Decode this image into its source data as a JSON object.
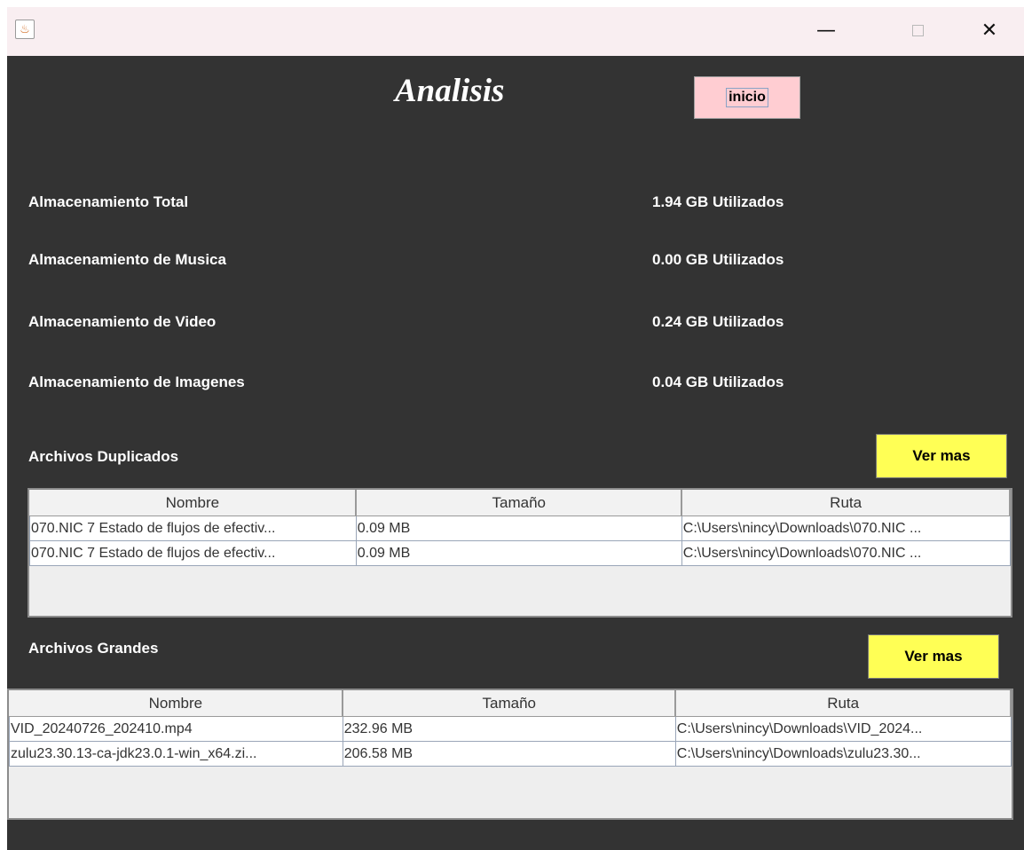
{
  "window": {
    "minimize_glyph": "—",
    "close_glyph": "✕",
    "icons": {
      "app": "java-app-icon",
      "minimize": "minimize-icon",
      "maximize": "maximize-icon",
      "close": "close-icon"
    }
  },
  "header": {
    "title": "Analisis",
    "inicio_label": "inicio"
  },
  "storage": [
    {
      "label": "Almacenamiento Total",
      "value": "1.94 GB Utilizados"
    },
    {
      "label": "Almacenamiento de Musica",
      "value": "0.00 GB Utilizados"
    },
    {
      "label": "Almacenamiento de Video",
      "value": "0.24 GB Utilizados"
    },
    {
      "label": "Almacenamiento de Imagenes",
      "value": "0.04 GB Utilizados"
    }
  ],
  "duplicados": {
    "title": "Archivos Duplicados",
    "button": "Ver mas",
    "columns": [
      "Nombre",
      "Tamaño",
      "Ruta"
    ],
    "rows": [
      [
        "070.NIC 7 Estado de flujos de efectiv...",
        "0.09 MB",
        "C:\\Users\\nincy\\Downloads\\070.NIC ..."
      ],
      [
        "070.NIC 7 Estado de flujos de efectiv...",
        "0.09 MB",
        "C:\\Users\\nincy\\Downloads\\070.NIC ..."
      ]
    ]
  },
  "grandes": {
    "title": "Archivos Grandes",
    "button": "Ver mas",
    "columns": [
      "Nombre",
      "Tamaño",
      "Ruta"
    ],
    "rows": [
      [
        "VID_20240726_202410.mp4",
        "232.96 MB",
        "C:\\Users\\nincy\\Downloads\\VID_2024..."
      ],
      [
        "zulu23.30.13-ca-jdk23.0.1-win_x64.zi...",
        "206.58 MB",
        "C:\\Users\\nincy\\Downloads\\zulu23.30..."
      ]
    ]
  },
  "colors": {
    "background": "#333333",
    "inicio_button": "#ffcdd2",
    "ver_mas_button": "#ffff55",
    "titlebar": "#f9eef1"
  }
}
